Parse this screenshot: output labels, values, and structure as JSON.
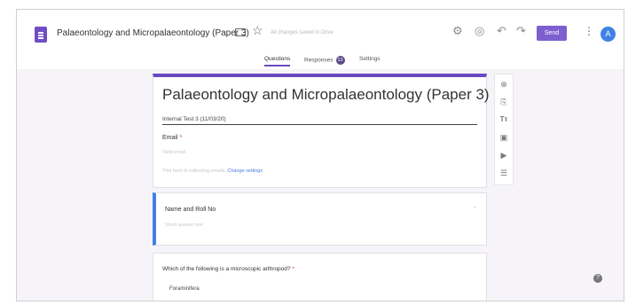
{
  "header": {
    "title": "Palaeontology and Micropalaeontology (Paper 3)",
    "saved_status": "All changes saved in Drive",
    "send_label": "Send",
    "avatar_initial": "A"
  },
  "tabs": [
    {
      "label": "Questions",
      "active": true
    },
    {
      "label": "Responses",
      "badge": "13"
    },
    {
      "label": "Settings"
    }
  ],
  "form": {
    "title": "Palaeontology and Micropalaeontology (Paper 3)",
    "description": "Internal Test 3 (11/03/20)",
    "email_label": "Email",
    "email_required_mark": "*",
    "email_hint": "Valid email",
    "email_note": "This form is collecting emails.",
    "email_note_link": "Change settings"
  },
  "questions": [
    {
      "title": "Name and Roll No",
      "hint": "Short answer text"
    },
    {
      "title": "Which of the following is a microscopic arthropod?",
      "required_mark": "*",
      "option": "Foraminifera"
    }
  ],
  "icons": [
    "doc-icon",
    "folder-icon",
    "star-icon",
    "palette-icon",
    "preview-icon",
    "undo-icon",
    "redo-icon",
    "more-icon",
    "add-question-icon",
    "import-icon",
    "title-icon",
    "image-icon",
    "video-icon",
    "section-icon",
    "help-icon"
  ],
  "colors": {
    "accent": "#6a49c2",
    "send": "#7d5fcf",
    "avatar": "#3f82e6",
    "required": "#d93025"
  }
}
